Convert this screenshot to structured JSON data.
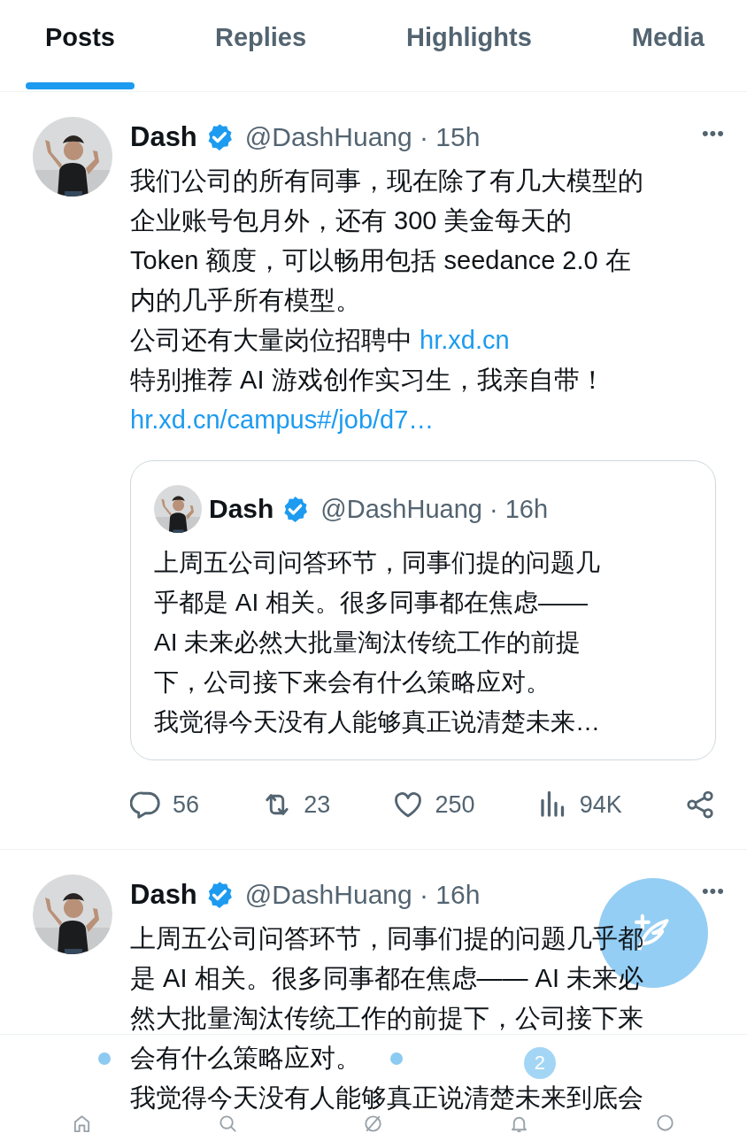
{
  "tabs": [
    {
      "label": "Posts",
      "selected": true
    },
    {
      "label": "Replies",
      "selected": false
    },
    {
      "label": "Highlights",
      "selected": false
    },
    {
      "label": "Media",
      "selected": false
    }
  ],
  "posts": [
    {
      "name": "Dash",
      "verified": true,
      "meta": "@DashHuang · 15h",
      "more": "•••",
      "body": [
        {
          "text": "我们公司的所有同事，现在除了有几大模型的"
        },
        {
          "text": "企业账号包月外，还有 300 美金每天的"
        },
        {
          "text": "Token 额度，可以畅用包括 seedance 2.0 在"
        },
        {
          "text": "内的几乎所有模型。"
        },
        {
          "text": "公司还有大量岗位招聘中 ",
          "link": "hr.xd.cn"
        },
        {
          "text": "特别推荐 AI 游戏创作实习生，我亲自带！"
        },
        {
          "link": "hr.xd.cn/campus#/job/d7…"
        }
      ],
      "quote": {
        "name": "Dash",
        "verified": true,
        "meta": "@DashHuang · 16h",
        "body": [
          {
            "text": "上周五公司问答环节，同事们提的问题几"
          },
          {
            "text": "乎都是 AI 相关。很多同事都在焦虑——"
          },
          {
            "text": "AI 未来必然大批量淘汰传统工作的前提"
          },
          {
            "text": "下，公司接下来会有什么策略应对。"
          },
          {
            "text": "我觉得今天没有人能够真正说清楚未来…"
          }
        ]
      },
      "stats": {
        "replies": "56",
        "reposts": "23",
        "likes": "250",
        "views": "94K"
      }
    },
    {
      "name": "Dash",
      "verified": true,
      "meta": "@DashHuang · 16h",
      "more": "•••",
      "body": [
        {
          "text": "上周五公司问答环节，同事们提的问题几乎都"
        },
        {
          "text": "是 AI 相关。很多同事都在焦虑—— AI 未来必"
        },
        {
          "text": "然大批量淘汰传统工作的前提下，公司接下来"
        },
        {
          "text": "会有什么策略应对。"
        },
        {
          "text": "我觉得今天没有人能够真正说清楚未来到底会"
        }
      ]
    }
  ],
  "nav": [
    {
      "kind": "home",
      "dot": true
    },
    {
      "kind": "search",
      "dot": false
    },
    {
      "kind": "grok",
      "dot": true
    },
    {
      "kind": "notifications",
      "dot": false,
      "badge": "2"
    },
    {
      "kind": "circle",
      "dot": false
    }
  ]
}
